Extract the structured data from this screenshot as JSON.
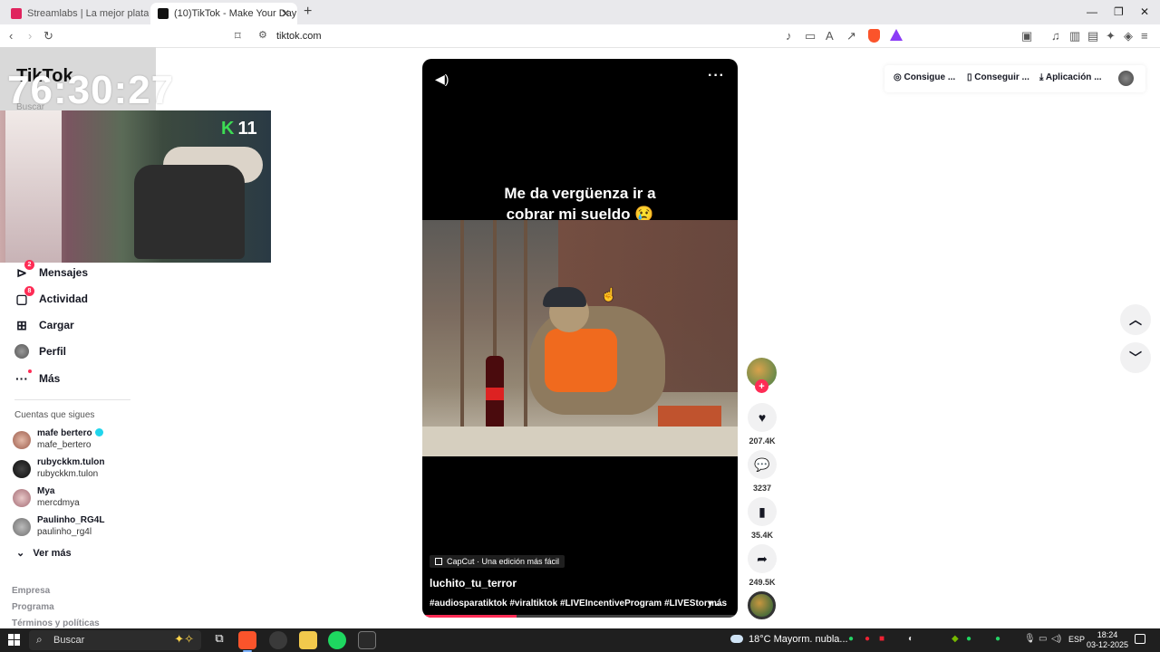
{
  "browser": {
    "tabs": [
      {
        "title": "Streamlabs | La mejor plataforma p...",
        "active": false
      },
      {
        "title": "(10)TikTok - Make Your Day",
        "active": true
      }
    ],
    "new_tab": "+",
    "address": "tiktok.com"
  },
  "overlay": {
    "logo": "TikTok",
    "timer": "76:30:27",
    "search_placeholder": "Buscar",
    "webcam_badge_number": "11"
  },
  "sidebar": {
    "items": [
      {
        "label": "Mensajes",
        "icon": "send-icon",
        "badge": "2"
      },
      {
        "label": "Actividad",
        "icon": "inbox-icon",
        "badge": "8"
      },
      {
        "label": "Cargar",
        "icon": "upload-icon"
      },
      {
        "label": "Perfil",
        "icon": "avatar-icon"
      },
      {
        "label": "Más",
        "icon": "more-dots-icon"
      }
    ],
    "following_title": "Cuentas que sigues",
    "following": [
      {
        "name": "mafe bertero",
        "handle": "mafe_bertero",
        "verified": true
      },
      {
        "name": "rubyckkm.tulon",
        "handle": "rubyckkm.tulon",
        "verified": false
      },
      {
        "name": "Mya",
        "handle": "mercdmya",
        "verified": false
      },
      {
        "name": "Paulinho_RG4L",
        "handle": "paulinho_rg4l",
        "verified": false
      }
    ],
    "see_more": "Ver más",
    "footer": [
      "Empresa",
      "Programa",
      "Términos y políticas"
    ]
  },
  "video": {
    "caption_line1": "Me da vergüenza ir a",
    "caption_line2": "cobrar mi sueldo 😢",
    "capcut_label": "CapCut · Una edición más fácil",
    "author": "luchito_tu_terror",
    "hashtags": "#audiosparatiktok #viraltiktok #LIVEIncentiveProgram #LIVEStory ...",
    "more": "más",
    "progress": 0.3
  },
  "actions": {
    "likes": "207.4K",
    "comments": "3237",
    "saves": "35.4K",
    "shares": "249.5K"
  },
  "top_actions": {
    "coins": "Consigue ...",
    "device": "Conseguir ...",
    "app": "Aplicación ..."
  },
  "taskbar": {
    "search": "Buscar",
    "weather": "18°C  Mayorm. nubla...",
    "lang": "ESP",
    "time": "18:24",
    "date": "03-12-2025"
  },
  "colors": {
    "accent": "#fe2c55",
    "verified": "#20d5ec",
    "brave": "#fb542b"
  }
}
